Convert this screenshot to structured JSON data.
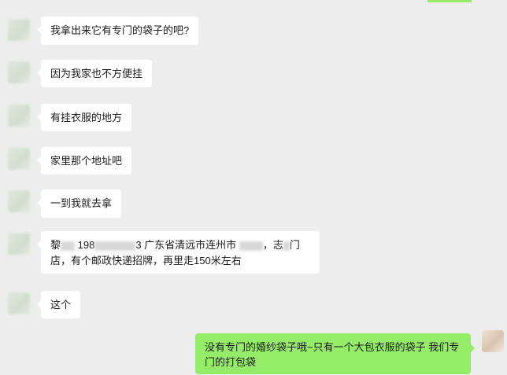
{
  "messages": [
    {
      "text": "我拿出来它有专门的袋子的吧?"
    },
    {
      "text": "因为我家也不方便挂"
    },
    {
      "text": "有挂衣服的地方"
    },
    {
      "text": "家里那个地址吧"
    },
    {
      "text": "一到我就去拿"
    },
    {
      "address": {
        "line1_a": "黎",
        "line1_b": "198",
        "line1_c": "3 广东省清远市连州市 ",
        "line1_d": "，志",
        "line1_e": "门",
        "line2": "店，有个邮政快递招牌，再里走150米左右"
      }
    },
    {
      "text": "这个"
    }
  ],
  "my_message": {
    "text": "没有专门的婚纱袋子哦~只有一个大包衣服的袋子 我们专门的打包袋"
  }
}
